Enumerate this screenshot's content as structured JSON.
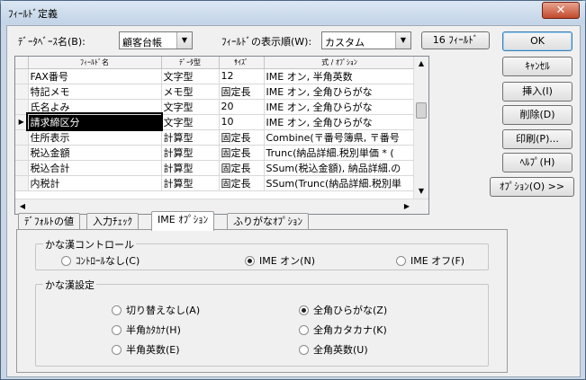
{
  "window": {
    "title": "ﾌｨｰﾙﾄﾞ定義",
    "close_glyph": "✕"
  },
  "top": {
    "db_label": "ﾃﾞｰﾀﾍﾞｰｽ名(B):",
    "db_value": "顧客台帳",
    "order_label": "ﾌｨｰﾙﾄﾞの表示順(W):",
    "order_value": "カスタム",
    "field_count": "16 ﾌｨｰﾙﾄﾞ"
  },
  "buttons": {
    "ok": "OK",
    "cancel": "ｷｬﾝｾﾙ",
    "insert": "挿入(I)",
    "delete": "削除(D)",
    "print": "印刷(P)...",
    "help": "ﾍﾙﾌﾟ(H)",
    "options": "ｵﾌﾟｼｮﾝ(O) >>"
  },
  "grid": {
    "columns": [
      "ﾌｨｰﾙﾄﾞ名",
      "ﾃﾞｰﾀ型",
      "ｻｲｽﾞ",
      "式 / ｵﾌﾟｼｮﾝ"
    ],
    "rows": [
      {
        "name": "FAX番号",
        "type": "文字型",
        "size": "12",
        "option": "IME オン, 半角英数"
      },
      {
        "name": "特記メモ",
        "type": "メモ型",
        "size": "固定長",
        "option": "IME オン, 全角ひらがな"
      },
      {
        "name": "氏名よみ",
        "type": "文字型",
        "size": "20",
        "option": "IME オン, 全角ひらがな"
      },
      {
        "name": "請求締区分",
        "type": "文字型",
        "size": "10",
        "option": "IME オン, 全角ひらがな",
        "selected": true
      },
      {
        "name": "住所表示",
        "type": "計算型",
        "size": "固定長",
        "option": "Combine(〒番号簿県, 〒番号"
      },
      {
        "name": "税込金額",
        "type": "計算型",
        "size": "固定長",
        "option": "Trunc(納品詳細.税別単価 * ("
      },
      {
        "name": "税込合計",
        "type": "計算型",
        "size": "固定長",
        "option": "SSum(税込金額), 納品詳細.の"
      },
      {
        "name": "内税計",
        "type": "計算型",
        "size": "固定長",
        "option": "SSum(Trunc(納品詳細.税別単"
      }
    ],
    "row_marker": "▶"
  },
  "tabs": [
    "ﾃﾞﾌｫﾙﾄの値",
    "入力ﾁｪｯｸ",
    "IME ｵﾌﾟｼｮﾝ",
    "ふりがなｵﾌﾟｼｮﾝ"
  ],
  "active_tab": "IME ｵﾌﾟｼｮﾝ",
  "ime_control": {
    "title": "かな漢コントロール",
    "options": [
      "ｺﾝﾄﾛｰﾙなし(C)",
      "IME オン(N)",
      "IME オフ(F)"
    ],
    "selected": "IME オン(N)"
  },
  "kana_setting": {
    "title": "かな漢設定",
    "options": [
      "切り替えなし(A)",
      "全角ひらがな(Z)",
      "半角ｶﾀｶﾅ(H)",
      "全角カタカナ(K)",
      "半角英数(E)",
      "全角英数(U)"
    ],
    "selected": "全角ひらがな(Z)"
  }
}
